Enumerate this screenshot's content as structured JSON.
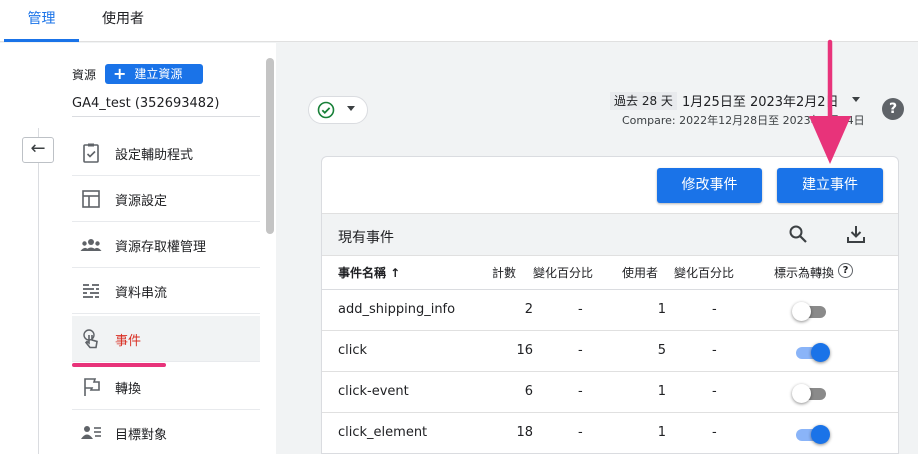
{
  "tabs": [
    {
      "label": "管理"
    },
    {
      "label": "使用者"
    }
  ],
  "property": {
    "label": "資源",
    "create_label": "建立資源",
    "name": "GA4_test (352693482)"
  },
  "nav": [
    {
      "label": "設定輔助程式",
      "icon": "clipboard-check-icon"
    },
    {
      "label": "資源設定",
      "icon": "layout-icon"
    },
    {
      "label": "資源存取權管理",
      "icon": "people-icon"
    },
    {
      "label": "資料串流",
      "icon": "streams-icon"
    },
    {
      "label": "事件",
      "icon": "touch-icon"
    },
    {
      "label": "轉換",
      "icon": "flag-icon"
    },
    {
      "label": "目標對象",
      "icon": "audience-icon"
    }
  ],
  "date": {
    "chip": "過去 28 天",
    "range": "1月25日至 2023年2月2日",
    "compare": "Compare: 2022年12月28日至 2023年1月24日"
  },
  "buttons": {
    "modify": "修改事件",
    "create": "建立事件"
  },
  "table": {
    "title": "現有事件",
    "headers": {
      "name": "事件名稱 ↑",
      "count": "計數",
      "count_change": "變化百分比",
      "users": "使用者",
      "users_change": "變化百分比",
      "conversion": "標示為轉換"
    },
    "rows": [
      {
        "name": "add_shipping_info",
        "count": "2",
        "count_change": "-",
        "users": "1",
        "users_change": "-",
        "conversion": false
      },
      {
        "name": "click",
        "count": "16",
        "count_change": "-",
        "users": "5",
        "users_change": "-",
        "conversion": true
      },
      {
        "name": "click-event",
        "count": "6",
        "count_change": "-",
        "users": "1",
        "users_change": "-",
        "conversion": false
      },
      {
        "name": "click_element",
        "count": "18",
        "count_change": "-",
        "users": "1",
        "users_change": "-",
        "conversion": true
      }
    ]
  },
  "colors": {
    "accent": "#1a73e8",
    "highlight": "#e8337a",
    "active_text": "#d93025"
  }
}
